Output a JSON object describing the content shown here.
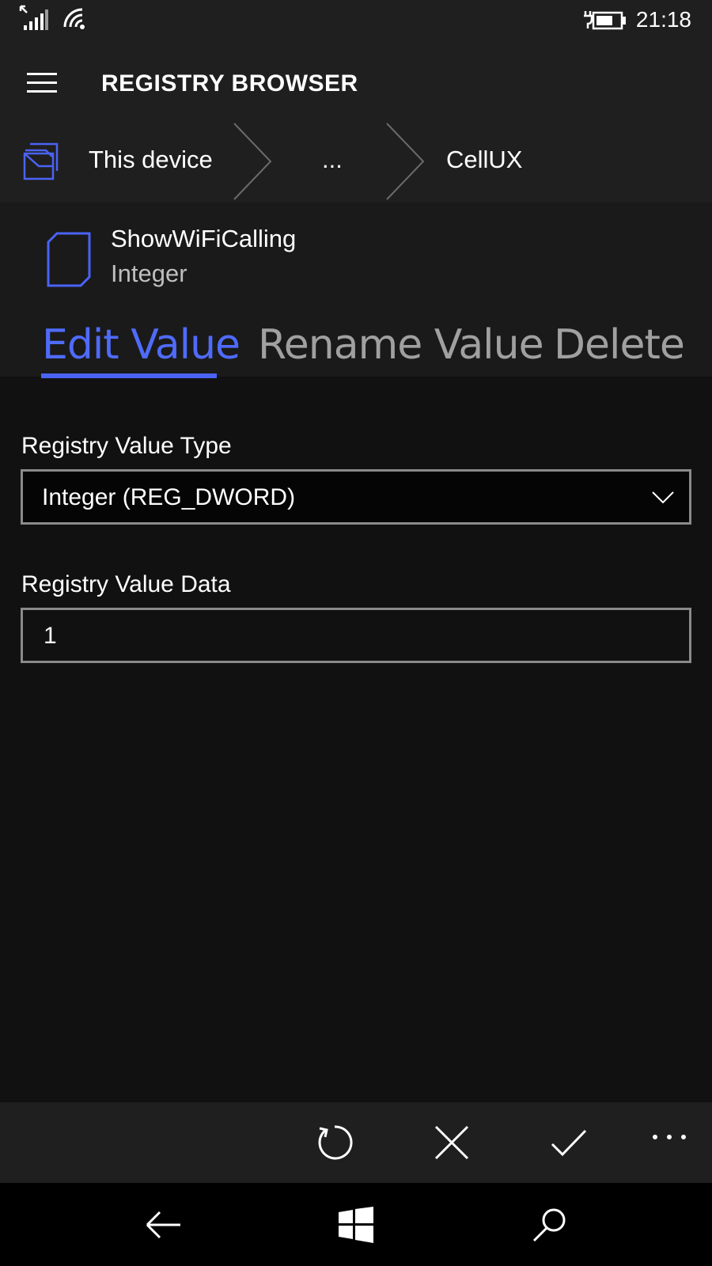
{
  "status": {
    "time": "21:18"
  },
  "header": {
    "title": "REGISTRY BROWSER"
  },
  "breadcrumb": {
    "items": [
      "This device",
      "...",
      "CellUX"
    ]
  },
  "value": {
    "name": "ShowWiFiCalling",
    "type": "Integer"
  },
  "tabs": {
    "items": [
      "Edit Value",
      "Rename Value",
      "Delete Value"
    ],
    "active": "Edit Value"
  },
  "form": {
    "type_label": "Registry Value Type",
    "type_value": "Integer (REG_DWORD)",
    "data_label": "Registry Value Data",
    "data_value": "1"
  },
  "commands": {
    "icons": [
      "refresh-icon",
      "cancel-icon",
      "accept-icon",
      "more-icon"
    ]
  },
  "navigation": {
    "icons": [
      "back-icon",
      "windows-icon",
      "search-icon"
    ]
  },
  "colors": {
    "accent": "#4a63f5",
    "background": "#111111",
    "bar": "#1f1f1f"
  }
}
